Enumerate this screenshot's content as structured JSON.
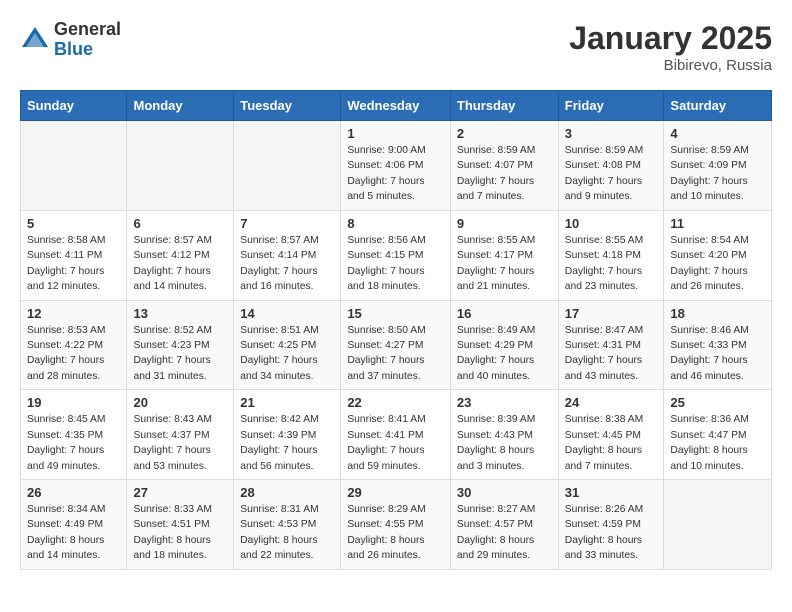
{
  "logo": {
    "general": "General",
    "blue": "Blue"
  },
  "title": "January 2025",
  "location": "Bibirevo, Russia",
  "weekdays": [
    "Sunday",
    "Monday",
    "Tuesday",
    "Wednesday",
    "Thursday",
    "Friday",
    "Saturday"
  ],
  "weeks": [
    [
      {
        "day": "",
        "sunrise": "",
        "sunset": "",
        "daylight": ""
      },
      {
        "day": "",
        "sunrise": "",
        "sunset": "",
        "daylight": ""
      },
      {
        "day": "",
        "sunrise": "",
        "sunset": "",
        "daylight": ""
      },
      {
        "day": "1",
        "sunrise": "Sunrise: 9:00 AM",
        "sunset": "Sunset: 4:06 PM",
        "daylight": "Daylight: 7 hours and 5 minutes."
      },
      {
        "day": "2",
        "sunrise": "Sunrise: 8:59 AM",
        "sunset": "Sunset: 4:07 PM",
        "daylight": "Daylight: 7 hours and 7 minutes."
      },
      {
        "day": "3",
        "sunrise": "Sunrise: 8:59 AM",
        "sunset": "Sunset: 4:08 PM",
        "daylight": "Daylight: 7 hours and 9 minutes."
      },
      {
        "day": "4",
        "sunrise": "Sunrise: 8:59 AM",
        "sunset": "Sunset: 4:09 PM",
        "daylight": "Daylight: 7 hours and 10 minutes."
      }
    ],
    [
      {
        "day": "5",
        "sunrise": "Sunrise: 8:58 AM",
        "sunset": "Sunset: 4:11 PM",
        "daylight": "Daylight: 7 hours and 12 minutes."
      },
      {
        "day": "6",
        "sunrise": "Sunrise: 8:57 AM",
        "sunset": "Sunset: 4:12 PM",
        "daylight": "Daylight: 7 hours and 14 minutes."
      },
      {
        "day": "7",
        "sunrise": "Sunrise: 8:57 AM",
        "sunset": "Sunset: 4:14 PM",
        "daylight": "Daylight: 7 hours and 16 minutes."
      },
      {
        "day": "8",
        "sunrise": "Sunrise: 8:56 AM",
        "sunset": "Sunset: 4:15 PM",
        "daylight": "Daylight: 7 hours and 18 minutes."
      },
      {
        "day": "9",
        "sunrise": "Sunrise: 8:55 AM",
        "sunset": "Sunset: 4:17 PM",
        "daylight": "Daylight: 7 hours and 21 minutes."
      },
      {
        "day": "10",
        "sunrise": "Sunrise: 8:55 AM",
        "sunset": "Sunset: 4:18 PM",
        "daylight": "Daylight: 7 hours and 23 minutes."
      },
      {
        "day": "11",
        "sunrise": "Sunrise: 8:54 AM",
        "sunset": "Sunset: 4:20 PM",
        "daylight": "Daylight: 7 hours and 26 minutes."
      }
    ],
    [
      {
        "day": "12",
        "sunrise": "Sunrise: 8:53 AM",
        "sunset": "Sunset: 4:22 PM",
        "daylight": "Daylight: 7 hours and 28 minutes."
      },
      {
        "day": "13",
        "sunrise": "Sunrise: 8:52 AM",
        "sunset": "Sunset: 4:23 PM",
        "daylight": "Daylight: 7 hours and 31 minutes."
      },
      {
        "day": "14",
        "sunrise": "Sunrise: 8:51 AM",
        "sunset": "Sunset: 4:25 PM",
        "daylight": "Daylight: 7 hours and 34 minutes."
      },
      {
        "day": "15",
        "sunrise": "Sunrise: 8:50 AM",
        "sunset": "Sunset: 4:27 PM",
        "daylight": "Daylight: 7 hours and 37 minutes."
      },
      {
        "day": "16",
        "sunrise": "Sunrise: 8:49 AM",
        "sunset": "Sunset: 4:29 PM",
        "daylight": "Daylight: 7 hours and 40 minutes."
      },
      {
        "day": "17",
        "sunrise": "Sunrise: 8:47 AM",
        "sunset": "Sunset: 4:31 PM",
        "daylight": "Daylight: 7 hours and 43 minutes."
      },
      {
        "day": "18",
        "sunrise": "Sunrise: 8:46 AM",
        "sunset": "Sunset: 4:33 PM",
        "daylight": "Daylight: 7 hours and 46 minutes."
      }
    ],
    [
      {
        "day": "19",
        "sunrise": "Sunrise: 8:45 AM",
        "sunset": "Sunset: 4:35 PM",
        "daylight": "Daylight: 7 hours and 49 minutes."
      },
      {
        "day": "20",
        "sunrise": "Sunrise: 8:43 AM",
        "sunset": "Sunset: 4:37 PM",
        "daylight": "Daylight: 7 hours and 53 minutes."
      },
      {
        "day": "21",
        "sunrise": "Sunrise: 8:42 AM",
        "sunset": "Sunset: 4:39 PM",
        "daylight": "Daylight: 7 hours and 56 minutes."
      },
      {
        "day": "22",
        "sunrise": "Sunrise: 8:41 AM",
        "sunset": "Sunset: 4:41 PM",
        "daylight": "Daylight: 7 hours and 59 minutes."
      },
      {
        "day": "23",
        "sunrise": "Sunrise: 8:39 AM",
        "sunset": "Sunset: 4:43 PM",
        "daylight": "Daylight: 8 hours and 3 minutes."
      },
      {
        "day": "24",
        "sunrise": "Sunrise: 8:38 AM",
        "sunset": "Sunset: 4:45 PM",
        "daylight": "Daylight: 8 hours and 7 minutes."
      },
      {
        "day": "25",
        "sunrise": "Sunrise: 8:36 AM",
        "sunset": "Sunset: 4:47 PM",
        "daylight": "Daylight: 8 hours and 10 minutes."
      }
    ],
    [
      {
        "day": "26",
        "sunrise": "Sunrise: 8:34 AM",
        "sunset": "Sunset: 4:49 PM",
        "daylight": "Daylight: 8 hours and 14 minutes."
      },
      {
        "day": "27",
        "sunrise": "Sunrise: 8:33 AM",
        "sunset": "Sunset: 4:51 PM",
        "daylight": "Daylight: 8 hours and 18 minutes."
      },
      {
        "day": "28",
        "sunrise": "Sunrise: 8:31 AM",
        "sunset": "Sunset: 4:53 PM",
        "daylight": "Daylight: 8 hours and 22 minutes."
      },
      {
        "day": "29",
        "sunrise": "Sunrise: 8:29 AM",
        "sunset": "Sunset: 4:55 PM",
        "daylight": "Daylight: 8 hours and 26 minutes."
      },
      {
        "day": "30",
        "sunrise": "Sunrise: 8:27 AM",
        "sunset": "Sunset: 4:57 PM",
        "daylight": "Daylight: 8 hours and 29 minutes."
      },
      {
        "day": "31",
        "sunrise": "Sunrise: 8:26 AM",
        "sunset": "Sunset: 4:59 PM",
        "daylight": "Daylight: 8 hours and 33 minutes."
      },
      {
        "day": "",
        "sunrise": "",
        "sunset": "",
        "daylight": ""
      }
    ]
  ]
}
